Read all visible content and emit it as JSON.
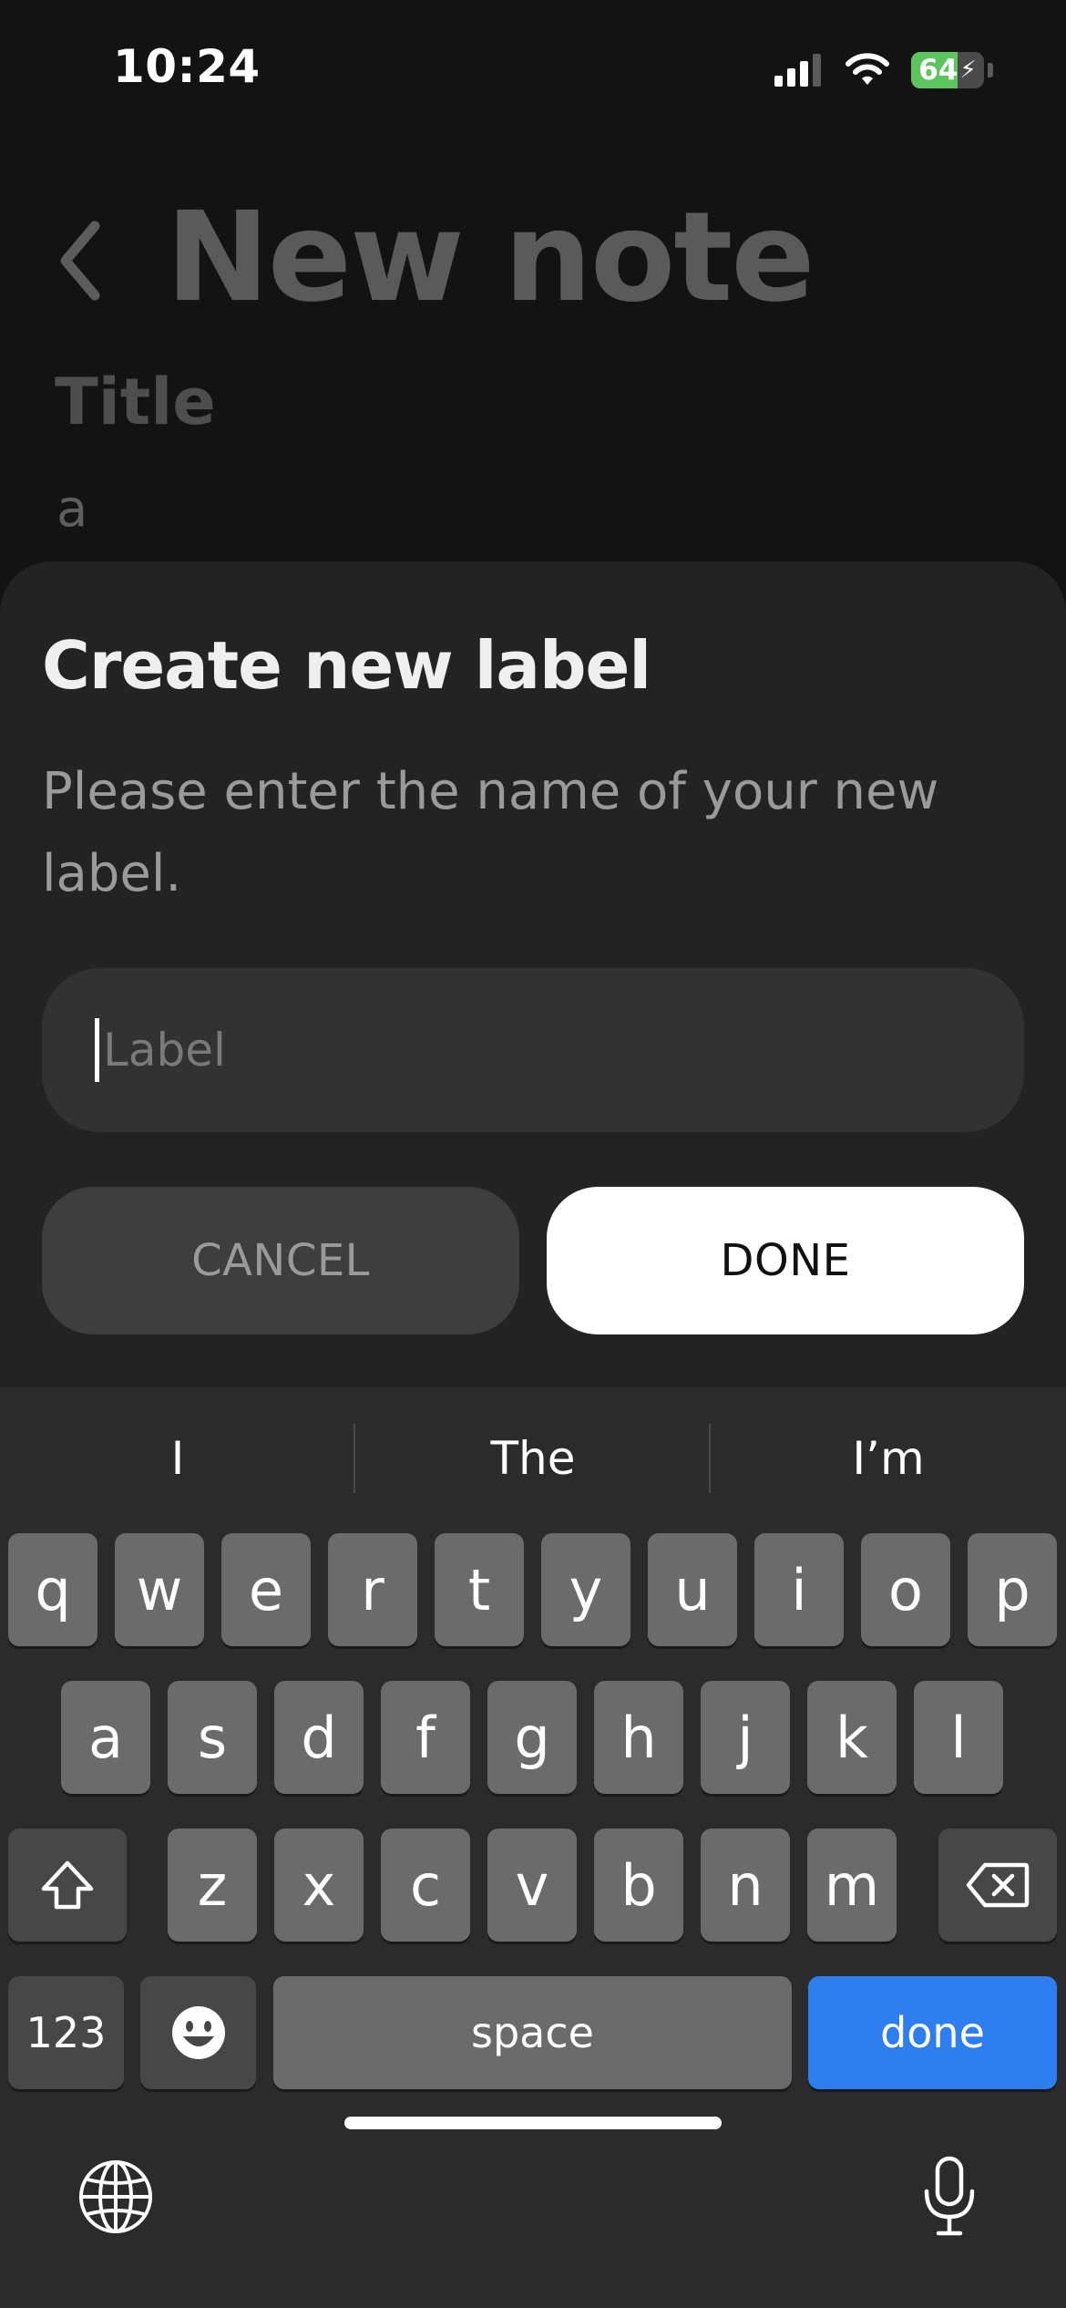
{
  "status_bar": {
    "time": "10:24",
    "battery_percent": "64",
    "battery_level": 0.64,
    "icons": [
      "cellular-signal-icon",
      "wifi-icon",
      "battery-charging-icon"
    ]
  },
  "background_page": {
    "back_icon": "chevron-left-icon",
    "title": "New note",
    "title_field_label": "Title",
    "body_text": "a"
  },
  "dialog": {
    "title": "Create new label",
    "description": "Please enter the name of your new label.",
    "input": {
      "placeholder": "Label",
      "value": ""
    },
    "cancel_label": "CANCEL",
    "done_label": "DONE"
  },
  "keyboard": {
    "suggestions": [
      "I",
      "The",
      "I’m"
    ],
    "row1": [
      "q",
      "w",
      "e",
      "r",
      "t",
      "y",
      "u",
      "i",
      "o",
      "p"
    ],
    "row2": [
      "a",
      "s",
      "d",
      "f",
      "g",
      "h",
      "j",
      "k",
      "l"
    ],
    "row3": [
      "z",
      "x",
      "c",
      "v",
      "b",
      "n",
      "m"
    ],
    "numbers_label": "123",
    "space_label": "space",
    "return_label": "done",
    "return_color": "#2f7ef0",
    "icons": [
      "shift-icon",
      "backspace-icon",
      "emoji-icon",
      "globe-icon",
      "microphone-icon"
    ]
  }
}
